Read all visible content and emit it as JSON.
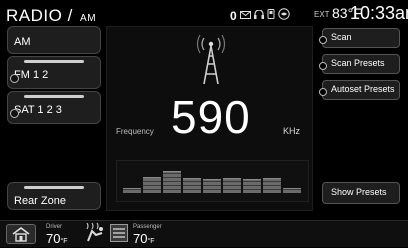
{
  "header": {
    "title": "RADIO",
    "slash": "/",
    "subtitle": "AM",
    "channel_num": "0",
    "ext_label": "EXT",
    "outside_temp": "83°F",
    "time": "10:33am",
    "icons": [
      "mail-icon",
      "headphones-icon",
      "phone-icon",
      "voice-icon"
    ]
  },
  "left_buttons": [
    {
      "label": "AM",
      "name": "am"
    },
    {
      "label": "FM    1   2",
      "name": "fm"
    },
    {
      "label": "SAT   1 2 3",
      "name": "sat"
    },
    {
      "label": "Rear Zone",
      "name": "rear-zone"
    }
  ],
  "center": {
    "frequency_label": "Frequency",
    "frequency_value": "590",
    "frequency_unit": "KHz"
  },
  "eq_levels": [
    0.15,
    0.55,
    0.75,
    0.5,
    0.45,
    0.5,
    0.45,
    0.5,
    0.15
  ],
  "right_buttons": [
    {
      "label": "Scan",
      "name": "scan"
    },
    {
      "label": "Scan Presets",
      "name": "scan-presets"
    },
    {
      "label": "Autoset Presets",
      "name": "autoset-presets"
    },
    {
      "label": "Show Presets",
      "name": "show-presets"
    }
  ],
  "bottom": {
    "driver_label": "Driver",
    "driver_temp": "70",
    "passenger_label": "Passenger",
    "passenger_temp": "70",
    "temp_unit": "°F"
  },
  "colors": {
    "background": "#000000",
    "button": "#1e1e1e",
    "text": "#ffffff"
  }
}
